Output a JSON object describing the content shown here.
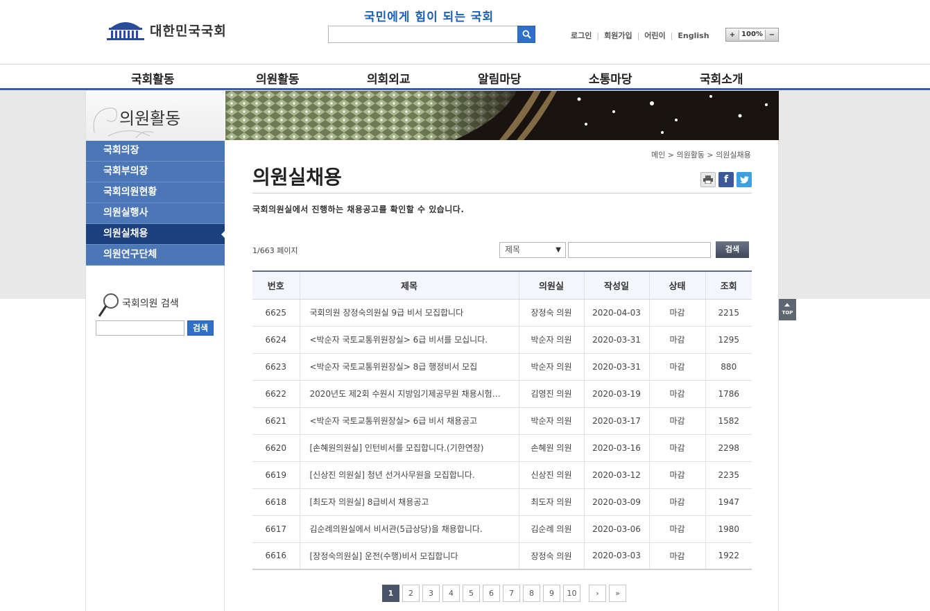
{
  "header": {
    "logo_text": "대한민국국회",
    "slogan": "국민에게 힘이 되는 국회",
    "search_placeholder": "",
    "util_links": [
      "로그인",
      "회원가입",
      "어린이",
      "English"
    ],
    "zoom": {
      "plus": "+",
      "value": "100%",
      "minus": "−"
    }
  },
  "gnb": [
    "국회활동",
    "의원활동",
    "의회외교",
    "알림마당",
    "소통마당",
    "국회소개"
  ],
  "lnb": {
    "title": "의원활동",
    "menu": [
      "국회의장",
      "국회부의장",
      "국회의원현황",
      "의원실행사",
      "의원실채용",
      "의원연구단체"
    ],
    "active_index": 4,
    "member_search": {
      "label": "국회의원 검색",
      "button": "검색"
    }
  },
  "content": {
    "breadcrumb": "메인 > 의원활동 > 의원실채용",
    "title": "의원실채용",
    "description": "국회의원실에서 진행하는 채용공고를 확인할 수 있습니다.",
    "page_info": "1/663 페이지",
    "filter": {
      "select_value": "제목",
      "button": "검색"
    }
  },
  "table": {
    "headers": [
      "번호",
      "제목",
      "의원실",
      "작성일",
      "상태",
      "조회"
    ],
    "rows": [
      [
        "6625",
        "국회의원 장정숙의원실 9급 비서 모집합니다",
        "장정숙 의원",
        "2020-04-03",
        "마감",
        "2215"
      ],
      [
        "6624",
        "<박순자 국토교통위원장실> 6급 비서를 모십니다.",
        "박순자 의원",
        "2020-03-31",
        "마감",
        "1295"
      ],
      [
        "6623",
        "<박순자 국토교통위원장실> 8급 행정비서 모집",
        "박순자 의원",
        "2020-03-31",
        "마감",
        "880"
      ],
      [
        "6622",
        "2020년도 제2회 수원시 지방임기제공무원 채용시험…",
        "김영진 의원",
        "2020-03-19",
        "마감",
        "1786"
      ],
      [
        "6621",
        "<박순자 국토교통위원장실> 6급 비서 채용공고",
        "박순자 의원",
        "2020-03-17",
        "마감",
        "1582"
      ],
      [
        "6620",
        "[손혜원의원실] 인턴비서를 모집합니다.(기한연장)",
        "손혜원 의원",
        "2020-03-16",
        "마감",
        "2298"
      ],
      [
        "6619",
        "[신상진 의원실] 청년 선거사무원을 모집합니다.",
        "신상진 의원",
        "2020-03-12",
        "마감",
        "2235"
      ],
      [
        "6618",
        "[최도자 의원실] 8급비서 채용공고",
        "최도자 의원",
        "2020-03-09",
        "마감",
        "1947"
      ],
      [
        "6617",
        "김순례의원실에서 비서관(5급상당)을 채용합니다.",
        "김순례 의원",
        "2020-03-06",
        "마감",
        "1980"
      ],
      [
        "6616",
        "[장정숙의원실] 운전(수행)비서 모집합니다",
        "장정숙 의원",
        "2020-03-03",
        "마감",
        "1922"
      ]
    ]
  },
  "paging": {
    "pages": [
      "1",
      "2",
      "3",
      "4",
      "5",
      "6",
      "7",
      "8",
      "9",
      "10"
    ],
    "current": "1",
    "next": "›",
    "last": "»"
  },
  "top_button": "TOP",
  "colors": {
    "brand_blue": "#2f6fc6",
    "lnb_blue": "#4b77b8",
    "lnb_active": "#1c3f7d",
    "gnb_line": "#3a5baf"
  }
}
